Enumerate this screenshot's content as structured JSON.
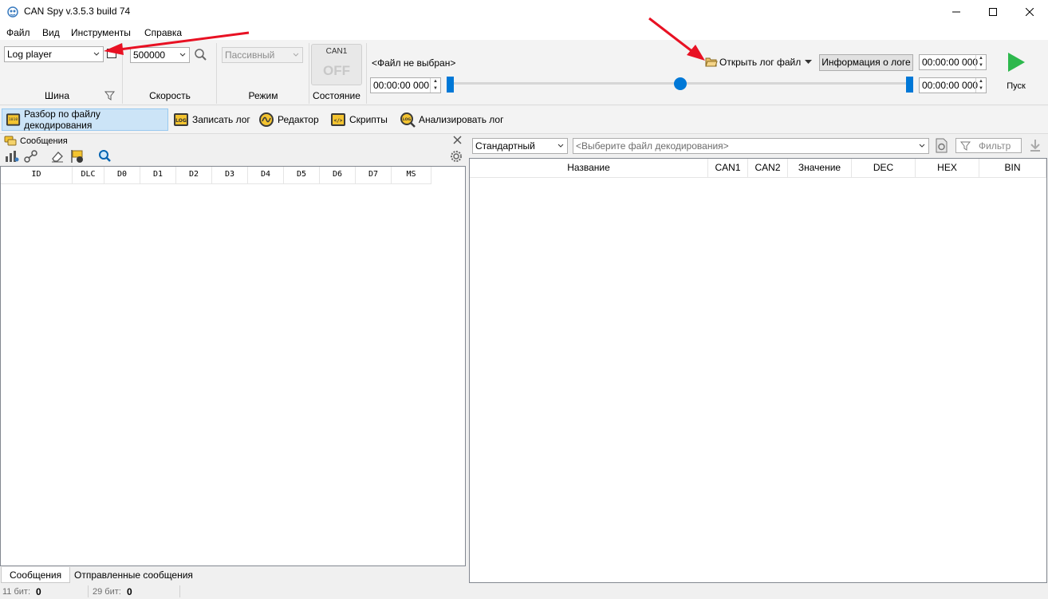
{
  "window": {
    "title": "CAN Spy v.3.5.3 build 74"
  },
  "menu": {
    "items": [
      "Файл",
      "Вид",
      "Инструменты",
      "Справка"
    ]
  },
  "ribbon": {
    "bus": {
      "selected": "Log player",
      "group_label": "Шина"
    },
    "speed": {
      "selected": "500000",
      "group_label": "Скорость"
    },
    "mode": {
      "selected": "Пассивный",
      "group_label": "Режим"
    },
    "state": {
      "channel": "CAN1",
      "value": "OFF",
      "group_label": "Состояние"
    },
    "log": {
      "file_name": "<Файл не выбран>",
      "start_time": "00:00:00  000",
      "open_label": "Открыть лог файл",
      "info_label": "Информация о логе",
      "time_top_right": "00:00:00 000",
      "time_bottom_right": "00:00:00 000",
      "play_label": "Пуск",
      "position": 0.5
    }
  },
  "toolbar": {
    "items": [
      {
        "label": "Разбор по файлу декодирования",
        "icon": "decode-file-icon",
        "active": true
      },
      {
        "label": "Записать лог",
        "icon": "log-record-icon",
        "active": false
      },
      {
        "label": "Редактор",
        "icon": "editor-icon",
        "active": false
      },
      {
        "label": "Скрипты",
        "icon": "scripts-icon",
        "active": false
      },
      {
        "label": "Анализировать лог",
        "icon": "analyze-log-icon",
        "active": false
      }
    ]
  },
  "messages_panel": {
    "title": "Сообщения",
    "columns": [
      "ID",
      "DLC",
      "D0",
      "D1",
      "D2",
      "D3",
      "D4",
      "D5",
      "D6",
      "D7",
      "MS"
    ],
    "rows": []
  },
  "decode_panel": {
    "profile": "Стандартный",
    "file_placeholder": "<Выберите файл декодирования>",
    "filter_placeholder": "Фильтр",
    "columns": [
      "Название",
      "CAN1",
      "CAN2",
      "Значение",
      "DEC",
      "HEX",
      "BIN"
    ],
    "rows": []
  },
  "bottom_tabs": [
    "Сообщения",
    "Отправленные сообщения"
  ],
  "status": {
    "bits11_label": "11 бит:",
    "bits11_value": "0",
    "bits29_label": "29 бит:",
    "bits29_value": "0"
  },
  "colors": {
    "accent": "#0078d7",
    "arrow": "#e81123",
    "play": "#2db84d",
    "active_tab": "#cce4f7"
  }
}
